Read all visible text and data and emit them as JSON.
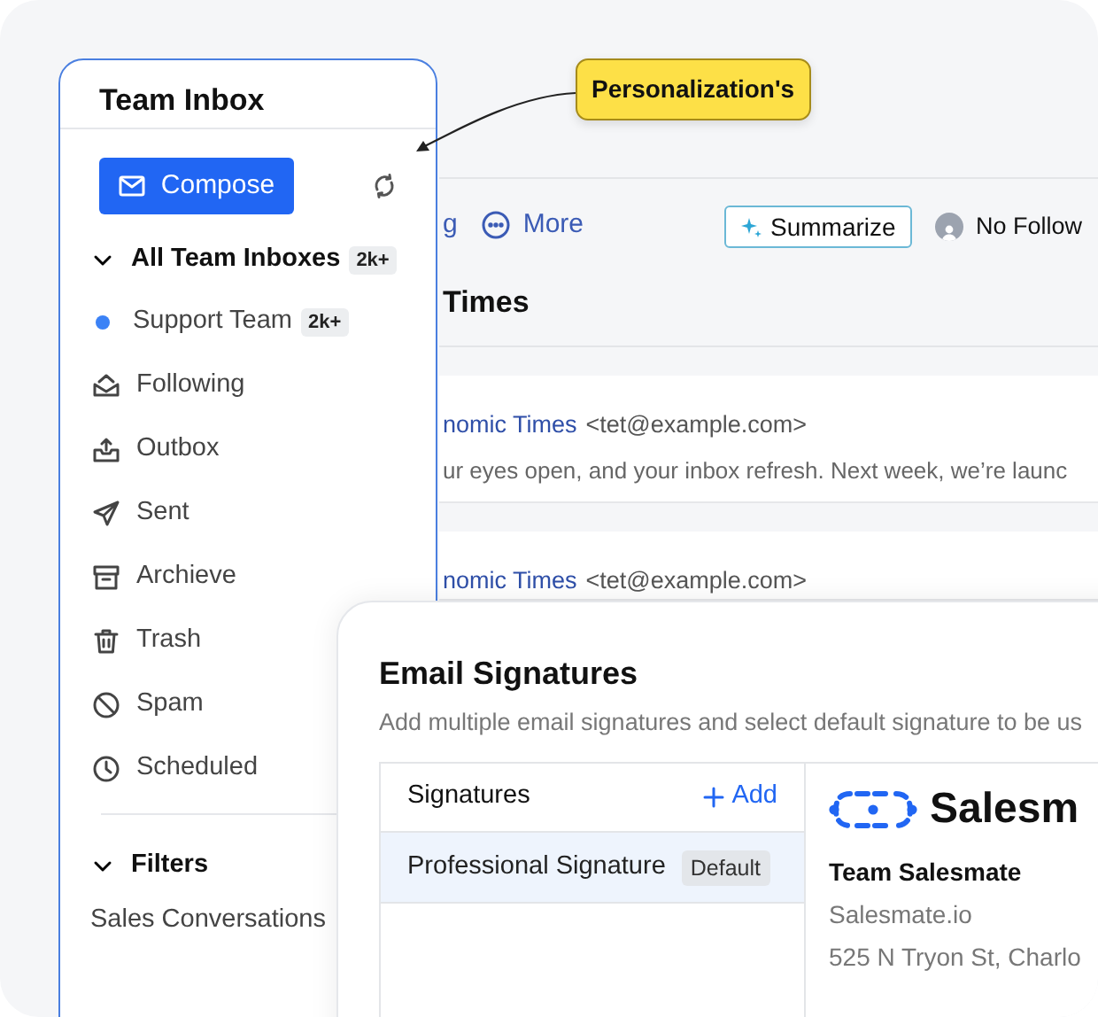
{
  "annotation": {
    "label": "Personalization's"
  },
  "toolbar": {
    "partial_item": "g",
    "more_button": "More",
    "summarize_button": "Summarize",
    "follow_status": "No Follow"
  },
  "mail_list": {
    "heading": "Times",
    "messages": [
      {
        "sender": "nomic Times",
        "email": "<tet@example.com>",
        "preview": "ur eyes open, and your inbox refresh. Next week, we’re launc"
      },
      {
        "sender": "nomic Times",
        "email": "<tet@example.com>"
      }
    ]
  },
  "sidebar": {
    "title": "Team Inbox",
    "compose_button": "Compose",
    "inbox_group": {
      "label": "All Team Inboxes",
      "badge": "2k+",
      "expanded": true,
      "children": [
        {
          "label": "Support Team",
          "badge": "2k+",
          "color": "#3b82f6"
        }
      ]
    },
    "items": [
      {
        "label": "Following"
      },
      {
        "label": "Outbox"
      },
      {
        "label": "Sent"
      },
      {
        "label": "Archieve"
      },
      {
        "label": "Trash"
      },
      {
        "label": "Spam"
      },
      {
        "label": "Scheduled"
      }
    ],
    "filters": {
      "label": "Filters",
      "expanded": true,
      "items": [
        "Sales Conversations"
      ]
    }
  },
  "signatures_dialog": {
    "title": "Email Signatures",
    "subtitle": "Add multiple email signatures and select default signature to be us",
    "list_header": "Signatures",
    "add_button": "Add",
    "signatures": [
      {
        "name": "Professional Signature",
        "badge": "Default",
        "selected": true
      }
    ],
    "preview": {
      "logo_text": "Salesm",
      "name": "Team Salesmate",
      "website": "Salesmate.io",
      "address": "525 N Tryon St, Charlo"
    }
  }
}
